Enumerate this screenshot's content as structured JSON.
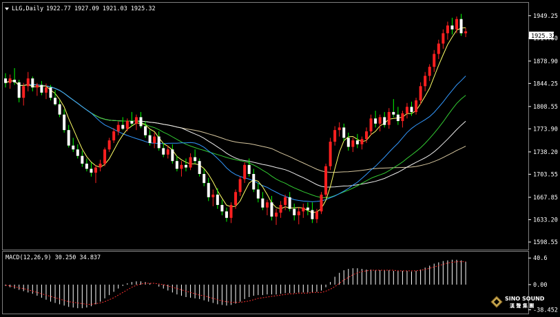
{
  "header": {
    "symbol": "LLG,Daily",
    "ohlc": "1922.77 1927.09 1921.03 1925.32"
  },
  "price_axis": {
    "ticks": [
      "1949.25",
      "1914.60",
      "1878.90",
      "1844.25",
      "1808.55",
      "1773.90",
      "1738.20",
      "1703.55",
      "1667.85",
      "1633.20",
      "1598.55"
    ],
    "current_price_label": "1925.32"
  },
  "macd_panel": {
    "label": "MACD(12,26,9) 30.250 34.837",
    "ticks": [
      "40.6",
      "0.00",
      "-38.452"
    ]
  },
  "logo": {
    "brand": "SINO SOUND",
    "chinese": "漢 聲 集 團"
  },
  "colors": {
    "bull": "#ff2020",
    "bear": "#ffffff",
    "bear_wick": "#00ff00",
    "ma_fast": "#ffff66",
    "ma_mid_green": "#33cc33",
    "ma_blue": "#3399ff",
    "ma_white": "#eeeeee",
    "ma_tan": "#d8c8a0",
    "macd_hist": "#ffffff",
    "macd_signal": "#ff3030"
  },
  "chart_data": {
    "type": "candlestick",
    "title": "LLG,Daily",
    "ylim": [
      1590,
      1965
    ],
    "price_ticks": [
      1949.25,
      1914.6,
      1878.9,
      1844.25,
      1808.55,
      1773.9,
      1738.2,
      1703.55,
      1667.85,
      1633.2,
      1598.55
    ],
    "candles": [
      [
        1852,
        1860,
        1838,
        1845
      ],
      [
        1845,
        1858,
        1836,
        1852
      ],
      [
        1850,
        1868,
        1842,
        1846
      ],
      [
        1846,
        1850,
        1815,
        1822
      ],
      [
        1822,
        1845,
        1810,
        1840
      ],
      [
        1840,
        1862,
        1832,
        1852
      ],
      [
        1852,
        1855,
        1832,
        1838
      ],
      [
        1838,
        1845,
        1825,
        1842
      ],
      [
        1842,
        1848,
        1826,
        1830
      ],
      [
        1830,
        1844,
        1820,
        1838
      ],
      [
        1838,
        1842,
        1818,
        1822
      ],
      [
        1822,
        1834,
        1810,
        1812
      ],
      [
        1812,
        1818,
        1792,
        1796
      ],
      [
        1796,
        1804,
        1768,
        1772
      ],
      [
        1772,
        1780,
        1745,
        1748
      ],
      [
        1748,
        1760,
        1738,
        1742
      ],
      [
        1742,
        1750,
        1728,
        1732
      ],
      [
        1732,
        1740,
        1715,
        1720
      ],
      [
        1720,
        1728,
        1708,
        1712
      ],
      [
        1712,
        1722,
        1700,
        1706
      ],
      [
        1706,
        1718,
        1690,
        1714
      ],
      [
        1714,
        1726,
        1708,
        1720
      ],
      [
        1720,
        1745,
        1716,
        1742
      ],
      [
        1742,
        1760,
        1738,
        1756
      ],
      [
        1756,
        1775,
        1752,
        1770
      ],
      [
        1770,
        1785,
        1764,
        1780
      ],
      [
        1780,
        1792,
        1772,
        1774
      ],
      [
        1774,
        1790,
        1770,
        1786
      ],
      [
        1786,
        1800,
        1778,
        1782
      ],
      [
        1782,
        1796,
        1772,
        1792
      ],
      [
        1792,
        1800,
        1775,
        1778
      ],
      [
        1778,
        1786,
        1760,
        1764
      ],
      [
        1764,
        1772,
        1748,
        1752
      ],
      [
        1752,
        1768,
        1744,
        1762
      ],
      [
        1762,
        1770,
        1740,
        1744
      ],
      [
        1744,
        1752,
        1730,
        1734
      ],
      [
        1734,
        1748,
        1728,
        1742
      ],
      [
        1742,
        1750,
        1720,
        1724
      ],
      [
        1724,
        1732,
        1708,
        1712
      ],
      [
        1712,
        1724,
        1700,
        1718
      ],
      [
        1718,
        1728,
        1708,
        1714
      ],
      [
        1714,
        1736,
        1710,
        1730
      ],
      [
        1730,
        1742,
        1720,
        1724
      ],
      [
        1724,
        1728,
        1700,
        1704
      ],
      [
        1704,
        1712,
        1685,
        1690
      ],
      [
        1690,
        1698,
        1662,
        1668
      ],
      [
        1668,
        1680,
        1654,
        1672
      ],
      [
        1672,
        1682,
        1650,
        1656
      ],
      [
        1656,
        1664,
        1640,
        1646
      ],
      [
        1646,
        1652,
        1630,
        1636
      ],
      [
        1636,
        1660,
        1628,
        1656
      ],
      [
        1656,
        1680,
        1650,
        1676
      ],
      [
        1676,
        1700,
        1670,
        1696
      ],
      [
        1696,
        1722,
        1690,
        1718
      ],
      [
        1718,
        1728,
        1700,
        1704
      ],
      [
        1704,
        1712,
        1676,
        1680
      ],
      [
        1680,
        1690,
        1660,
        1666
      ],
      [
        1666,
        1676,
        1648,
        1652
      ],
      [
        1652,
        1664,
        1640,
        1660
      ],
      [
        1660,
        1670,
        1632,
        1638
      ],
      [
        1638,
        1650,
        1625,
        1644
      ],
      [
        1644,
        1662,
        1636,
        1656
      ],
      [
        1656,
        1672,
        1648,
        1668
      ],
      [
        1668,
        1676,
        1646,
        1650
      ],
      [
        1650,
        1658,
        1632,
        1640
      ],
      [
        1640,
        1652,
        1626,
        1646
      ],
      [
        1646,
        1658,
        1636,
        1652
      ],
      [
        1652,
        1660,
        1640,
        1648
      ],
      [
        1648,
        1660,
        1628,
        1634
      ],
      [
        1634,
        1650,
        1628,
        1646
      ],
      [
        1646,
        1676,
        1642,
        1672
      ],
      [
        1672,
        1720,
        1668,
        1716
      ],
      [
        1716,
        1760,
        1710,
        1754
      ],
      [
        1754,
        1778,
        1748,
        1772
      ],
      [
        1772,
        1784,
        1762,
        1776
      ],
      [
        1776,
        1782,
        1755,
        1760
      ],
      [
        1760,
        1768,
        1740,
        1746
      ],
      [
        1746,
        1760,
        1738,
        1756
      ],
      [
        1756,
        1766,
        1744,
        1750
      ],
      [
        1750,
        1762,
        1742,
        1758
      ],
      [
        1758,
        1776,
        1752,
        1770
      ],
      [
        1770,
        1796,
        1764,
        1790
      ],
      [
        1790,
        1802,
        1776,
        1782
      ],
      [
        1782,
        1796,
        1770,
        1792
      ],
      [
        1792,
        1800,
        1776,
        1780
      ],
      [
        1780,
        1806,
        1774,
        1800
      ],
      [
        1800,
        1820,
        1792,
        1796
      ],
      [
        1796,
        1808,
        1780,
        1786
      ],
      [
        1786,
        1802,
        1776,
        1798
      ],
      [
        1798,
        1814,
        1790,
        1808
      ],
      [
        1808,
        1816,
        1794,
        1800
      ],
      [
        1800,
        1822,
        1796,
        1818
      ],
      [
        1818,
        1846,
        1812,
        1840
      ],
      [
        1840,
        1862,
        1832,
        1856
      ],
      [
        1856,
        1874,
        1848,
        1870
      ],
      [
        1870,
        1896,
        1862,
        1890
      ],
      [
        1890,
        1912,
        1882,
        1906
      ],
      [
        1906,
        1928,
        1898,
        1922
      ],
      [
        1922,
        1940,
        1912,
        1934
      ],
      [
        1934,
        1946,
        1920,
        1928
      ],
      [
        1928,
        1948,
        1922,
        1944
      ],
      [
        1944,
        1952,
        1918,
        1922
      ],
      [
        1922,
        1930,
        1916,
        1925
      ]
    ],
    "macd": {
      "label": "MACD(12,26,9)",
      "macd_value": 30.25,
      "signal_value": 34.837,
      "ylim": [
        -40,
        44
      ],
      "histogram": [
        -2,
        -4,
        -6,
        -8,
        -10,
        -12,
        -14,
        -17,
        -20,
        -23,
        -26,
        -28,
        -30,
        -32,
        -34,
        -35,
        -36,
        -36,
        -35,
        -33,
        -30,
        -26,
        -21,
        -16,
        -11,
        -6,
        -2,
        2,
        4,
        5,
        5,
        4,
        2,
        0,
        -3,
        -6,
        -9,
        -12,
        -15,
        -17,
        -19,
        -20,
        -21,
        -22,
        -24,
        -26,
        -28,
        -30,
        -31,
        -32,
        -31,
        -29,
        -26,
        -22,
        -19,
        -17,
        -16,
        -16,
        -15,
        -15,
        -15,
        -14,
        -13,
        -13,
        -13,
        -12,
        -12,
        -12,
        -12,
        -11,
        -9,
        -4,
        4,
        12,
        18,
        22,
        24,
        25,
        25,
        24,
        23,
        23,
        22,
        22,
        22,
        22,
        21,
        21,
        21,
        21,
        20,
        21,
        23,
        26,
        29,
        32,
        34,
        36,
        37,
        38,
        38,
        37,
        35
      ],
      "signal": [
        -1,
        -2,
        -3,
        -5,
        -6,
        -8,
        -10,
        -12,
        -14,
        -16,
        -18,
        -20,
        -22,
        -24,
        -26,
        -27,
        -28,
        -29,
        -30,
        -30,
        -29,
        -28,
        -26,
        -23,
        -20,
        -16,
        -12,
        -8,
        -4,
        -1,
        1,
        2,
        2,
        2,
        1,
        0,
        -2,
        -4,
        -6,
        -8,
        -10,
        -12,
        -14,
        -16,
        -17,
        -19,
        -21,
        -23,
        -25,
        -26,
        -27,
        -27,
        -27,
        -26,
        -25,
        -23,
        -21,
        -20,
        -19,
        -18,
        -17,
        -16,
        -15,
        -14,
        -14,
        -13,
        -13,
        -13,
        -12,
        -12,
        -12,
        -10,
        -7,
        -3,
        2,
        7,
        11,
        15,
        18,
        20,
        21,
        22,
        22,
        22,
        22,
        22,
        22,
        21,
        21,
        21,
        21,
        21,
        22,
        23,
        25,
        27,
        29,
        31,
        33,
        34,
        35,
        35,
        35
      ]
    }
  }
}
